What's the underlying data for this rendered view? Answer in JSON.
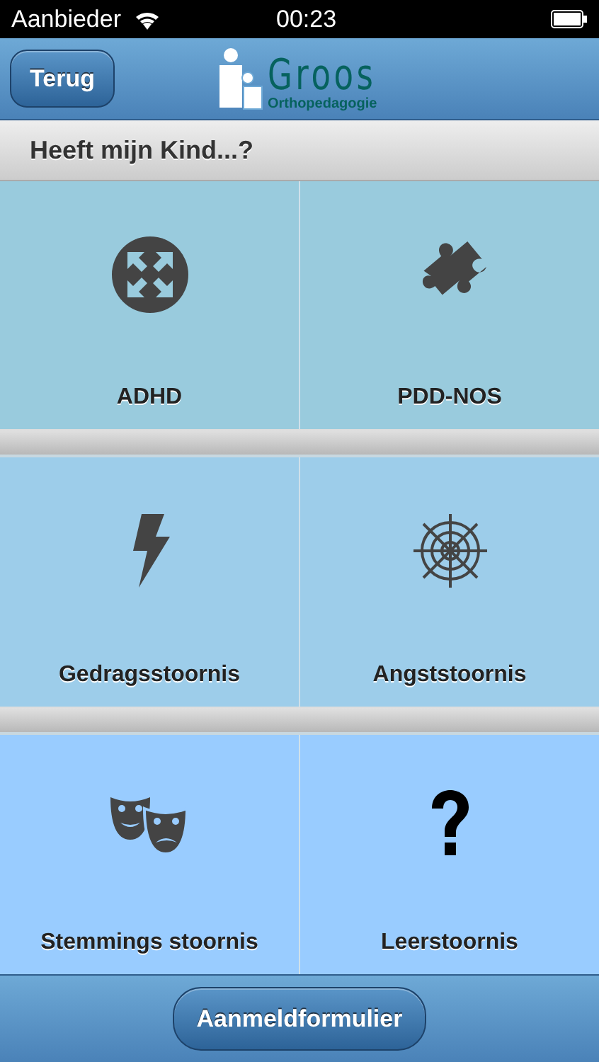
{
  "status_bar": {
    "carrier": "Aanbieder",
    "time": "00:23"
  },
  "nav_bar": {
    "back_button": "Terug",
    "logo": {
      "name": "Groos",
      "subtitle": "Orthopedagogie"
    }
  },
  "header": "Heeft mijn Kind...?",
  "sections": [
    {
      "color": "#99cbdd",
      "tiles": [
        {
          "label": "ADHD",
          "kind": "arrows"
        },
        {
          "label": "PDD-NOS",
          "kind": "puzzle"
        }
      ]
    },
    {
      "color": "#9dcdea",
      "tiles": [
        {
          "label": "Gedragsstoornis",
          "kind": "bolt"
        },
        {
          "label": "Angststoornis",
          "kind": "web"
        }
      ]
    },
    {
      "color": "#99ccff",
      "tiles": [
        {
          "label": "Stemmings stoornis",
          "kind": "masks"
        },
        {
          "label": "Leerstoornis",
          "kind": "question"
        }
      ]
    }
  ],
  "footer_button": "Aanmeldformulier"
}
